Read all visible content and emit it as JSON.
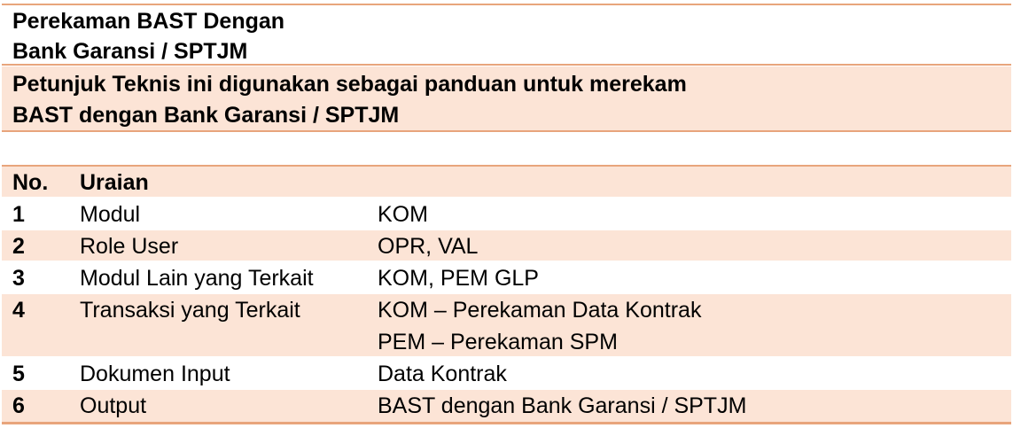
{
  "header": {
    "title_line1": "Perekaman BAST Dengan",
    "title_line2": "Bank Garansi / SPTJM",
    "desc_line1": "Petunjuk Teknis ini digunakan sebagai panduan untuk merekam",
    "desc_line2": "BAST dengan Bank Garansi / SPTJM"
  },
  "table": {
    "col_no": "No.",
    "col_uraian": "Uraian",
    "rows": [
      {
        "no": "1",
        "label": "Modul",
        "values": [
          "KOM"
        ]
      },
      {
        "no": "2",
        "label": "Role User",
        "values": [
          "OPR, VAL"
        ]
      },
      {
        "no": "3",
        "label": "Modul Lain yang Terkait",
        "values": [
          "KOM, PEM GLP"
        ]
      },
      {
        "no": "4",
        "label": "Transaksi yang Terkait",
        "values": [
          "KOM – Perekaman Data Kontrak",
          "PEM – Perekaman SPM"
        ]
      },
      {
        "no": "5",
        "label": "Dokumen Input",
        "values": [
          "Data Kontrak"
        ]
      },
      {
        "no": "6",
        "label": "Output",
        "values": [
          "BAST dengan Bank Garansi / SPTJM"
        ]
      }
    ]
  }
}
